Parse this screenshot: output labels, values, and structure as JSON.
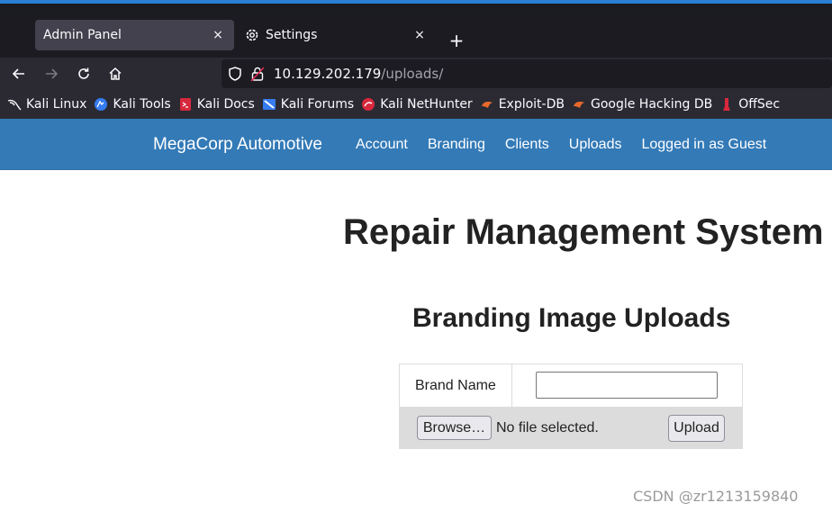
{
  "browser": {
    "tabs": [
      {
        "label": "Admin Panel",
        "close": "×"
      },
      {
        "label": "Settings",
        "close": "×"
      }
    ],
    "new_tab": "+",
    "url_host": "10.129.202.179",
    "url_path": "/uploads/",
    "bookmarks": [
      {
        "label": "Kali Linux",
        "icon": "kali-dragon-icon"
      },
      {
        "label": "Kali Tools",
        "icon": "kali-tools-icon"
      },
      {
        "label": "Kali Docs",
        "icon": "kali-docs-icon"
      },
      {
        "label": "Kali Forums",
        "icon": "kali-forums-icon"
      },
      {
        "label": "Kali NetHunter",
        "icon": "kali-nethunter-icon"
      },
      {
        "label": "Exploit-DB",
        "icon": "exploit-db-icon"
      },
      {
        "label": "Google Hacking DB",
        "icon": "ghdb-icon"
      },
      {
        "label": "OffSec",
        "icon": "offsec-icon"
      }
    ]
  },
  "site": {
    "brand": "MegaCorp Automotive",
    "nav": [
      "Account",
      "Branding",
      "Clients",
      "Uploads",
      "Logged in as Guest"
    ],
    "nav_color": "#337ab7"
  },
  "content": {
    "page_title": "Repair Management System",
    "section_title": "Branding Image Uploads",
    "form": {
      "brand_label": "Brand Name",
      "brand_value": "",
      "browse_label": "Browse…",
      "file_status": "No file selected.",
      "upload_label": "Upload"
    }
  },
  "watermark": "CSDN @zr1213159840"
}
